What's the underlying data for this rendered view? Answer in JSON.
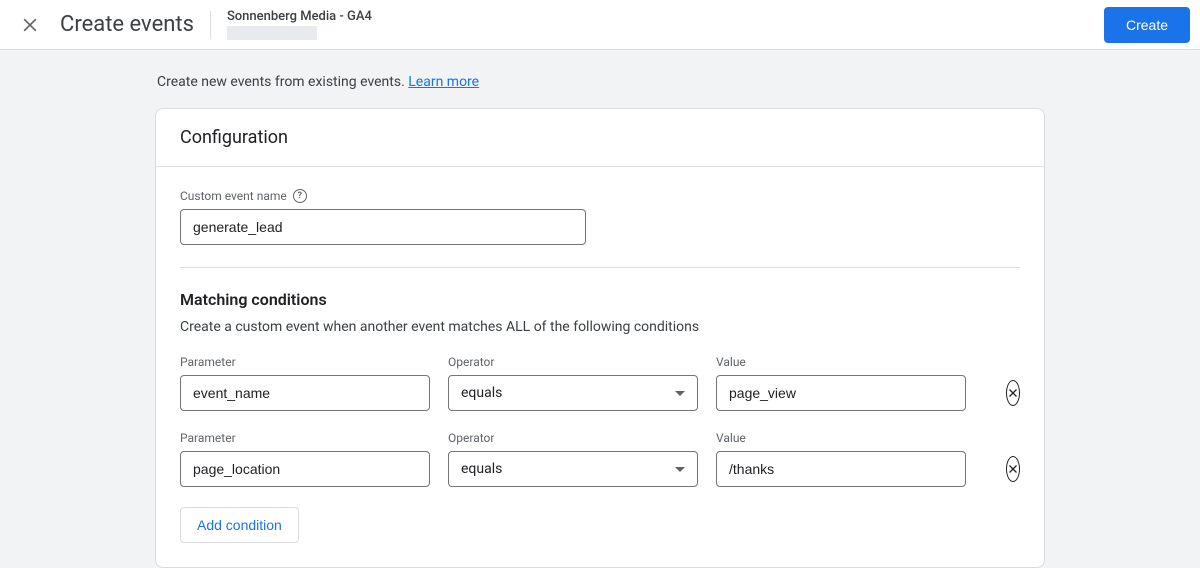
{
  "topbar": {
    "page_title": "Create events",
    "property_name": "Sonnenberg Media - GA4",
    "create_label": "Create"
  },
  "intro": {
    "text": "Create new events from existing events. ",
    "link": "Learn more"
  },
  "config": {
    "header": "Configuration",
    "custom_event_name_label": "Custom event name",
    "custom_event_name_value": "generate_lead"
  },
  "matching": {
    "title": "Matching conditions",
    "description": "Create a custom event when another event matches ALL of the following conditions",
    "labels": {
      "parameter": "Parameter",
      "operator": "Operator",
      "value": "Value"
    },
    "conditions": [
      {
        "parameter": "event_name",
        "operator": "equals",
        "value": "page_view"
      },
      {
        "parameter": "page_location",
        "operator": "equals",
        "value": "/thanks"
      }
    ],
    "add_label": "Add condition"
  }
}
